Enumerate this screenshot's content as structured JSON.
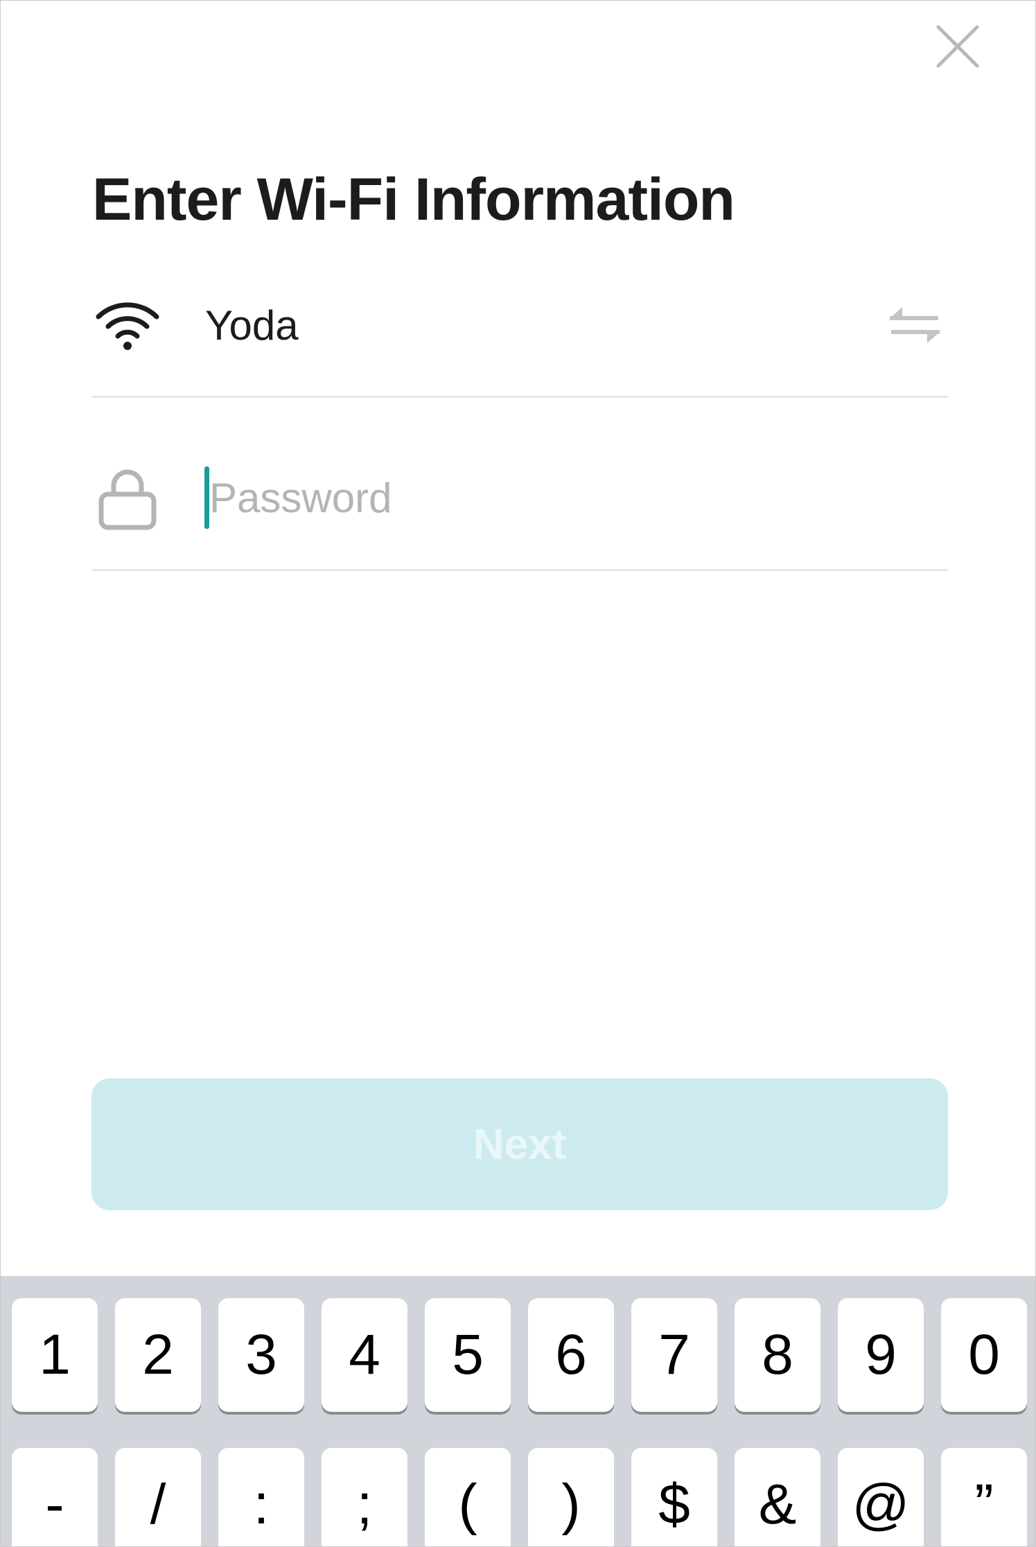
{
  "header": {
    "close_icon": "close-icon"
  },
  "title": "Enter Wi-Fi Information",
  "network": {
    "ssid": "Yoda",
    "wifi_icon": "wifi-icon",
    "switch_icon": "swap-arrows-icon"
  },
  "password": {
    "placeholder": "Password",
    "value": "",
    "lock_icon": "lock-icon"
  },
  "next_button": {
    "label": "Next",
    "enabled": false
  },
  "keyboard": {
    "row1": [
      "1",
      "2",
      "3",
      "4",
      "5",
      "6",
      "7",
      "8",
      "9",
      "0"
    ],
    "row2": [
      "-",
      "/",
      ":",
      ";",
      "(",
      ")",
      "$",
      "&",
      "@",
      "”"
    ]
  },
  "colors": {
    "accent": "#1a9a9a",
    "button_disabled_bg": "#cdebee",
    "keyboard_bg": "#d1d4da"
  }
}
